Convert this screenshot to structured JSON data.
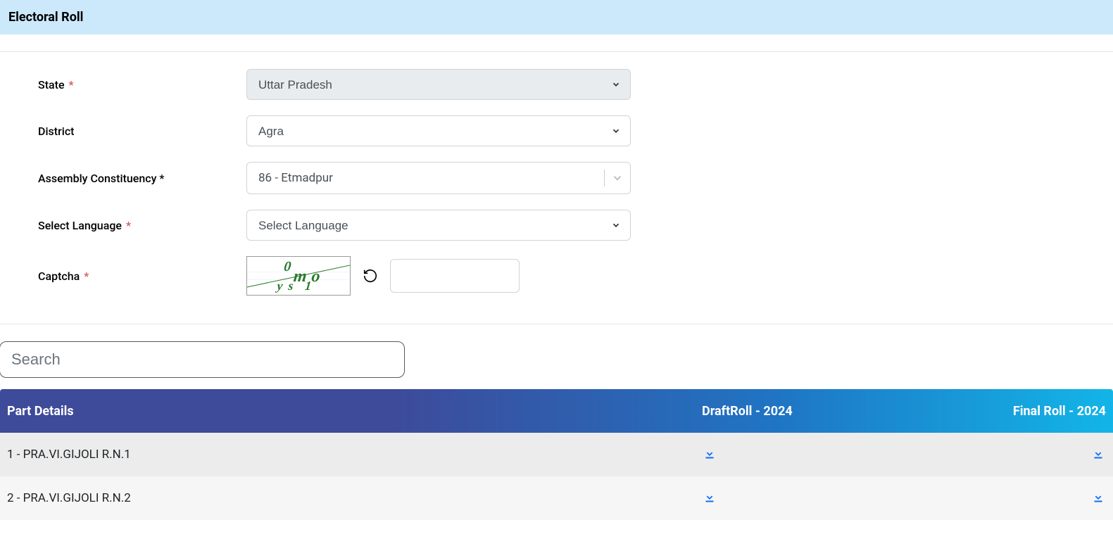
{
  "header": {
    "title": "Electoral Roll"
  },
  "form": {
    "state": {
      "label": "State",
      "value": "Uttar Pradesh",
      "required": true
    },
    "district": {
      "label": "District",
      "value": "Agra",
      "required": false
    },
    "ac": {
      "label": "Assembly Constituency *",
      "value": "86 - Etmadpur"
    },
    "language": {
      "label": "Select Language",
      "value": "Select Language",
      "required": true
    },
    "captcha": {
      "label": "Captcha",
      "text": "y0sm1o",
      "required": true
    }
  },
  "search": {
    "placeholder": "Search"
  },
  "table": {
    "columns": {
      "part": "Part Details",
      "draft": "DraftRoll - 2024",
      "final": "Final Roll - 2024"
    },
    "rows": [
      {
        "part": "1 - PRA.VI.GIJOLI R.N.1"
      },
      {
        "part": "2 - PRA.VI.GIJOLI R.N.2"
      }
    ]
  }
}
